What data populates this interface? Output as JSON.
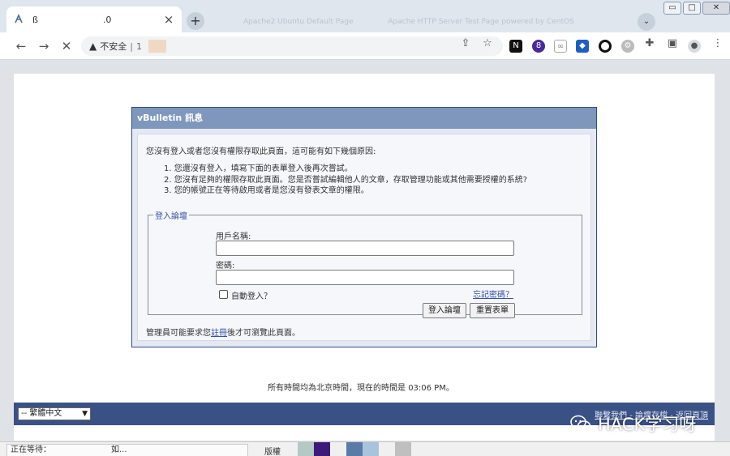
{
  "browser": {
    "tab_title": "ß",
    "tab_title_tail": ".0",
    "tab_close": "×",
    "new_tab": "+",
    "ghost_tabs": [
      "Apache2 Ubuntu Default Page",
      "Apache HTTP Server Test Page powered by CentOS"
    ],
    "tab_search": "⌄",
    "window_controls": {
      "min": "▭",
      "max": "□",
      "close": "✕"
    },
    "nav": {
      "back": "←",
      "forward": "→",
      "stop": "✕"
    },
    "omnibox": {
      "warning_icon": "warning-icon",
      "security_label": "不安全",
      "separator": "|",
      "url": "1"
    },
    "ext_badge": "8"
  },
  "dialog": {
    "header": "vBulletin 訊息",
    "intro": "您沒有登入或者您沒有權限存取此頁面，這可能有如下幾個原因:",
    "reasons": [
      "1. 您還沒有登入，填寫下面的表單登入後再次嘗試。",
      "2. 您沒有足夠的權限存取此頁面。您是否嘗試編輯他人的文章，存取管理功能或其他需要授權的系統?",
      "3. 您的帳號正在等待啟用或者是您沒有發表文章的權限。"
    ],
    "login": {
      "legend": "登入論壇",
      "username_label": "用戶名稱:",
      "username_value": "",
      "password_label": "密碼:",
      "password_value": "",
      "remember_label": "自動登入？",
      "forgot_link": "忘記密碼？",
      "submit_label": "登入論壇",
      "reset_label": "重置表單"
    },
    "admin_note_pre": "管理員可能要求您",
    "admin_note_link": "註冊",
    "admin_note_post": "後才可瀏覽此頁面。"
  },
  "footer": {
    "time_text": "所有時間均為北京時間，現在的時間是",
    "time_value": "03:06 PM",
    "time_suffix": "。",
    "language": "-- 繁體中文",
    "links": "聯繫我們 - 論壇存檔 - 返回頁頂"
  },
  "watermark": {
    "text": "HACK学习呀"
  },
  "status": {
    "left_text": "正在等待：",
    "right_text": "如...",
    "copyright_label": "版權"
  },
  "colors": {
    "header_bg": "#7f97bd",
    "footer_bg": "#3a5185",
    "link": "#3553a6",
    "swatches": [
      "#b4c8c6",
      "#3c1a7a",
      "#5a7aa8",
      "#a8c4dc",
      "#bfbfbf"
    ]
  }
}
